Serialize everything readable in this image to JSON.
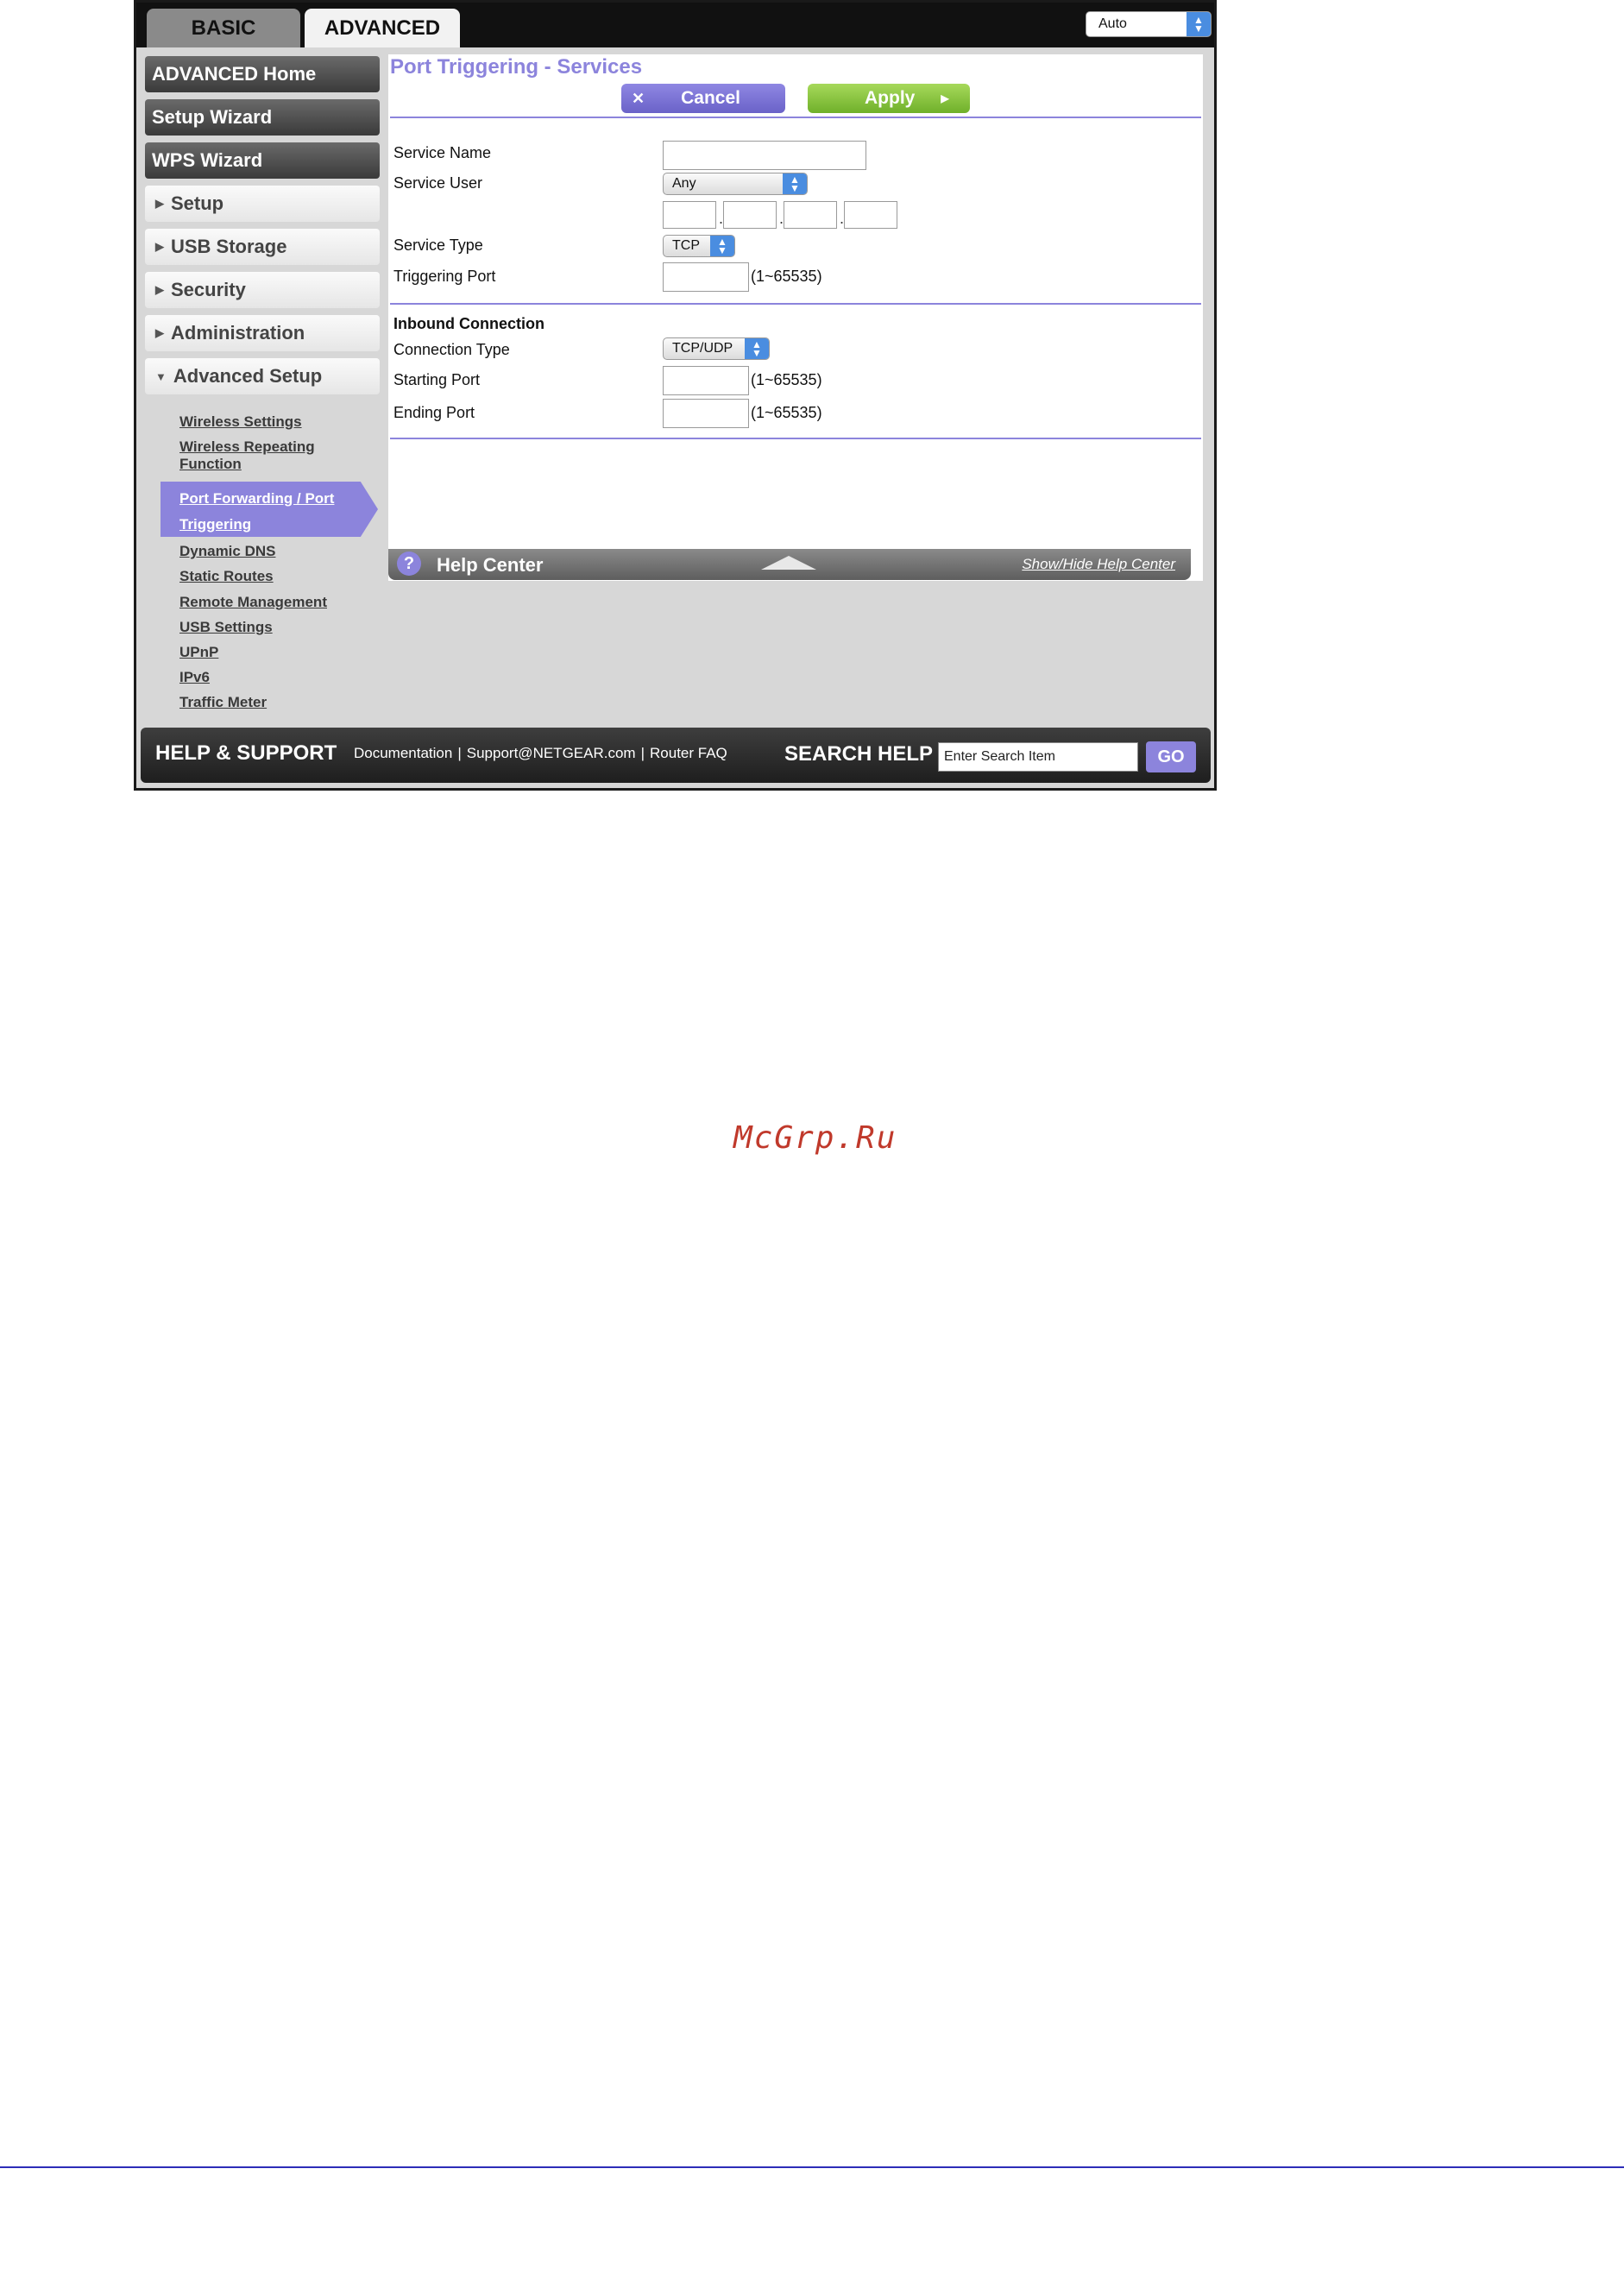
{
  "tabs": {
    "basic": "BASIC",
    "advanced": "ADVANCED"
  },
  "top_select": {
    "value": "Auto"
  },
  "sidebar": {
    "advanced_home": "ADVANCED Home",
    "setup_wizard": "Setup Wizard",
    "wps_wizard": "WPS Wizard",
    "setup": "Setup",
    "usb_storage": "USB Storage",
    "security": "Security",
    "administration": "Administration",
    "advanced_setup": "Advanced Setup",
    "sub": {
      "wireless_settings": "Wireless Settings",
      "wireless_repeating": "Wireless Repeating Function",
      "port_forwarding": "Port Forwarding / Port Triggering",
      "dynamic_dns": "Dynamic DNS",
      "static_routes": "Static Routes",
      "remote_management": "Remote Management",
      "usb_settings": "USB Settings",
      "upnp": "UPnP",
      "ipv6": "IPv6",
      "traffic_meter": "Traffic Meter"
    }
  },
  "main": {
    "title": "Port Triggering - Services",
    "cancel_label": "Cancel",
    "apply_label": "Apply",
    "service_name_label": "Service Name",
    "service_user_label": "Service User",
    "service_user_value": "Any",
    "service_type_label": "Service Type",
    "service_type_value": "TCP",
    "triggering_port_label": "Triggering Port",
    "range_hint": "(1~65535)",
    "inbound_heading": "Inbound Connection",
    "connection_type_label": "Connection Type",
    "connection_type_value": "TCP/UDP",
    "starting_port_label": "Starting Port",
    "ending_port_label": "Ending Port"
  },
  "help_center": {
    "label": "Help Center",
    "toggle_link": "Show/Hide Help Center"
  },
  "footer": {
    "help_support": "HELP & SUPPORT",
    "documentation": "Documentation",
    "support_email": "Support@NETGEAR.com",
    "router_faq": "Router FAQ",
    "search_help": "SEARCH HELP",
    "search_placeholder": "Enter Search Item",
    "go_label": "GO"
  },
  "watermark": "McGrp.Ru",
  "colors": {
    "accent": "#8c84dc",
    "apply_green": "#6fb02a",
    "bottom_rule": "#2d2db8"
  }
}
